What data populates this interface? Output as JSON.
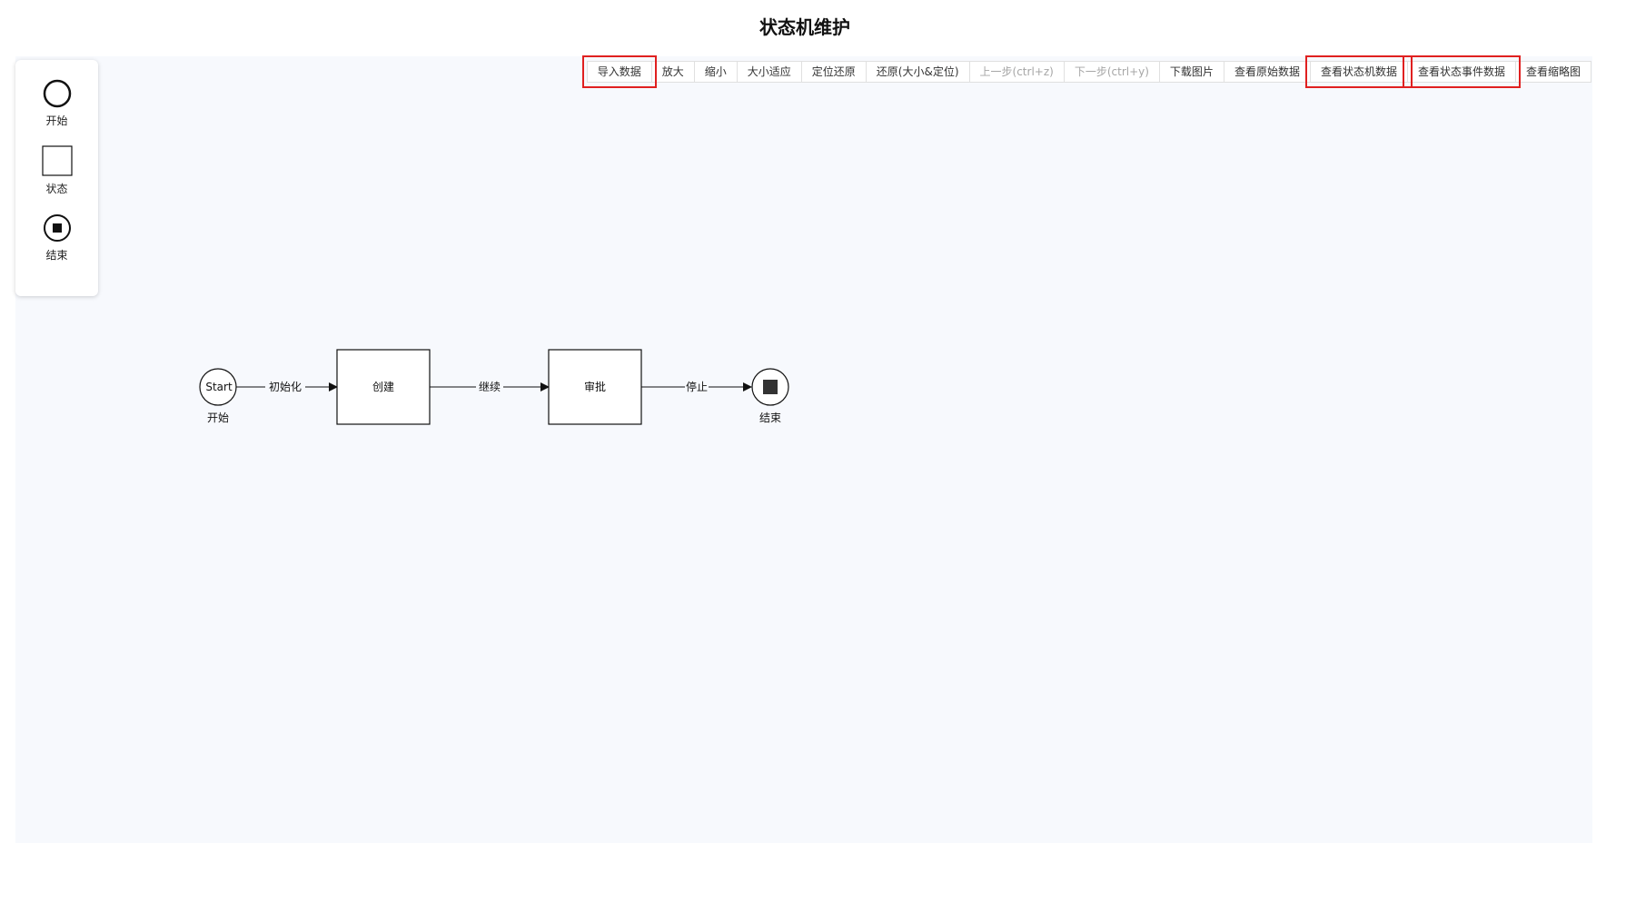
{
  "page": {
    "title": "状态机维护"
  },
  "palette": {
    "items": [
      {
        "label": "开始",
        "icon": "start-circle-icon"
      },
      {
        "label": "状态",
        "icon": "state-square-icon"
      },
      {
        "label": "结束",
        "icon": "end-circle-icon"
      }
    ]
  },
  "toolbar": {
    "buttons": [
      {
        "label": "导入数据",
        "highlighted": true,
        "disabled": false
      },
      {
        "label": "放大",
        "highlighted": false,
        "disabled": false
      },
      {
        "label": "缩小",
        "highlighted": false,
        "disabled": false
      },
      {
        "label": "大小适应",
        "highlighted": false,
        "disabled": false
      },
      {
        "label": "定位还原",
        "highlighted": false,
        "disabled": false
      },
      {
        "label": "还原(大小&定位)",
        "highlighted": false,
        "disabled": false
      },
      {
        "label": "上一步(ctrl+z)",
        "highlighted": false,
        "disabled": true
      },
      {
        "label": "下一步(ctrl+y)",
        "highlighted": false,
        "disabled": true
      },
      {
        "label": "下载图片",
        "highlighted": false,
        "disabled": false
      },
      {
        "label": "查看原始数据",
        "highlighted": false,
        "disabled": false
      },
      {
        "label": "查看状态机数据",
        "highlighted": true,
        "disabled": false
      },
      {
        "label": "查看状态事件数据",
        "highlighted": true,
        "disabled": false
      },
      {
        "label": "查看缩略图",
        "highlighted": false,
        "disabled": false
      }
    ],
    "highlight_color": "#e02020"
  },
  "diagram": {
    "start": {
      "text": "Start",
      "label": "开始"
    },
    "states": [
      {
        "label": "创建"
      },
      {
        "label": "审批"
      }
    ],
    "end": {
      "label": "结束"
    },
    "transitions": [
      {
        "label": "初始化"
      },
      {
        "label": "继续"
      },
      {
        "label": "停止"
      }
    ]
  }
}
